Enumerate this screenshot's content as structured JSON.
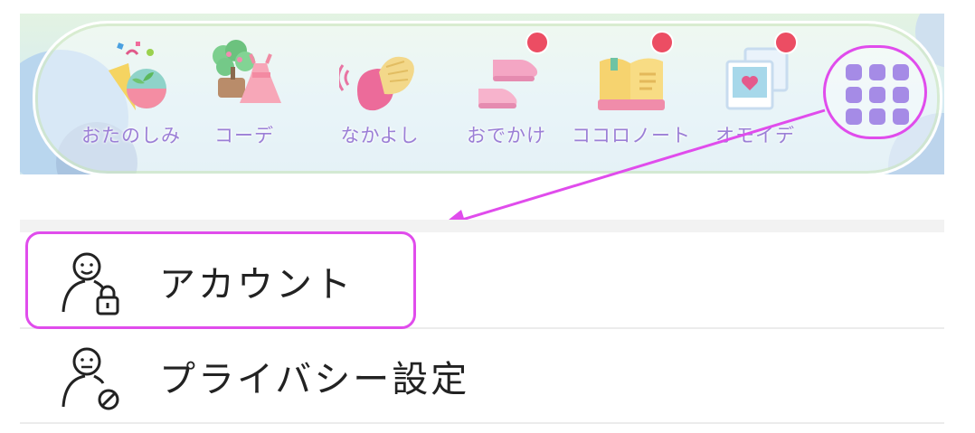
{
  "nav": {
    "items": [
      {
        "label": "おたのしみ",
        "icon": "party-cracker-icon",
        "badge": false
      },
      {
        "label": "コーデ",
        "icon": "dress-icon",
        "badge": false
      },
      {
        "label": "なかよし",
        "icon": "clapping-hands-icon",
        "badge": false
      },
      {
        "label": "おでかけ",
        "icon": "shoes-icon",
        "badge": true
      },
      {
        "label": "ココロノート",
        "icon": "notebook-icon",
        "badge": true
      },
      {
        "label": "オモイデ",
        "icon": "photo-album-icon",
        "badge": true
      }
    ],
    "menu_button_icon": "grid-menu-icon",
    "badge_color": "#ec4d63",
    "label_color": "#9b7fd6"
  },
  "annotation": {
    "highlight_color": "#e04cec"
  },
  "settings": {
    "items": [
      {
        "label": "アカウント",
        "icon": "user-lock-icon"
      },
      {
        "label": "プライバシー設定",
        "icon": "user-block-icon"
      }
    ]
  }
}
